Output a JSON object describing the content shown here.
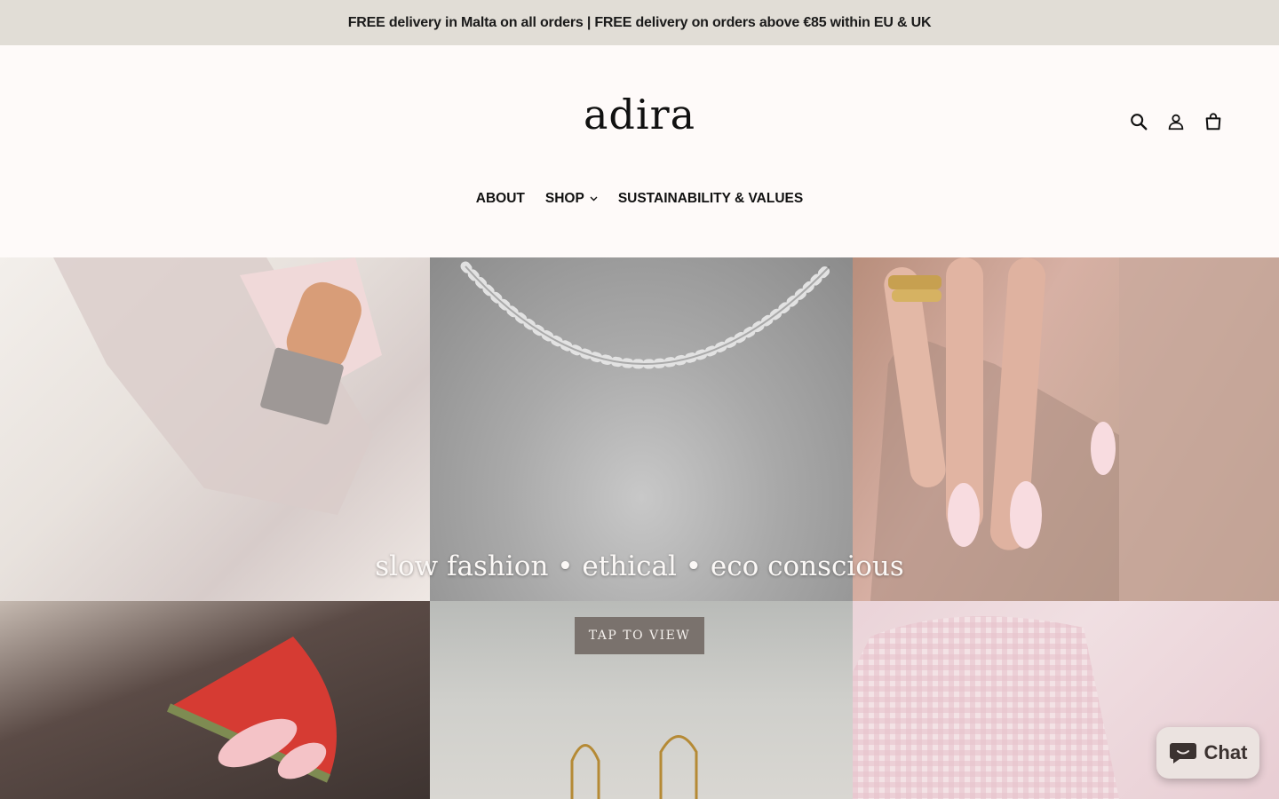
{
  "announcement": "FREE delivery in Malta on all orders | FREE delivery on orders above €85 within EU & UK",
  "brand": {
    "logo": "adira"
  },
  "header_icons": [
    "search-icon",
    "account-icon",
    "cart-icon"
  ],
  "nav": {
    "about": "ABOUT",
    "shop": "SHOP",
    "sustainability": "SUSTAINABILITY & VALUES"
  },
  "hero": {
    "tagline": "slow fashion • ethical • eco conscious",
    "cta": "TAP TO VIEW"
  },
  "chat": {
    "label": "Chat"
  },
  "colors": {
    "announcement_bg": "#e1ddd6",
    "header_bg": "#fefaf9",
    "cta_bg": "#7a726d",
    "chat_bg": "#ebe3e0"
  }
}
